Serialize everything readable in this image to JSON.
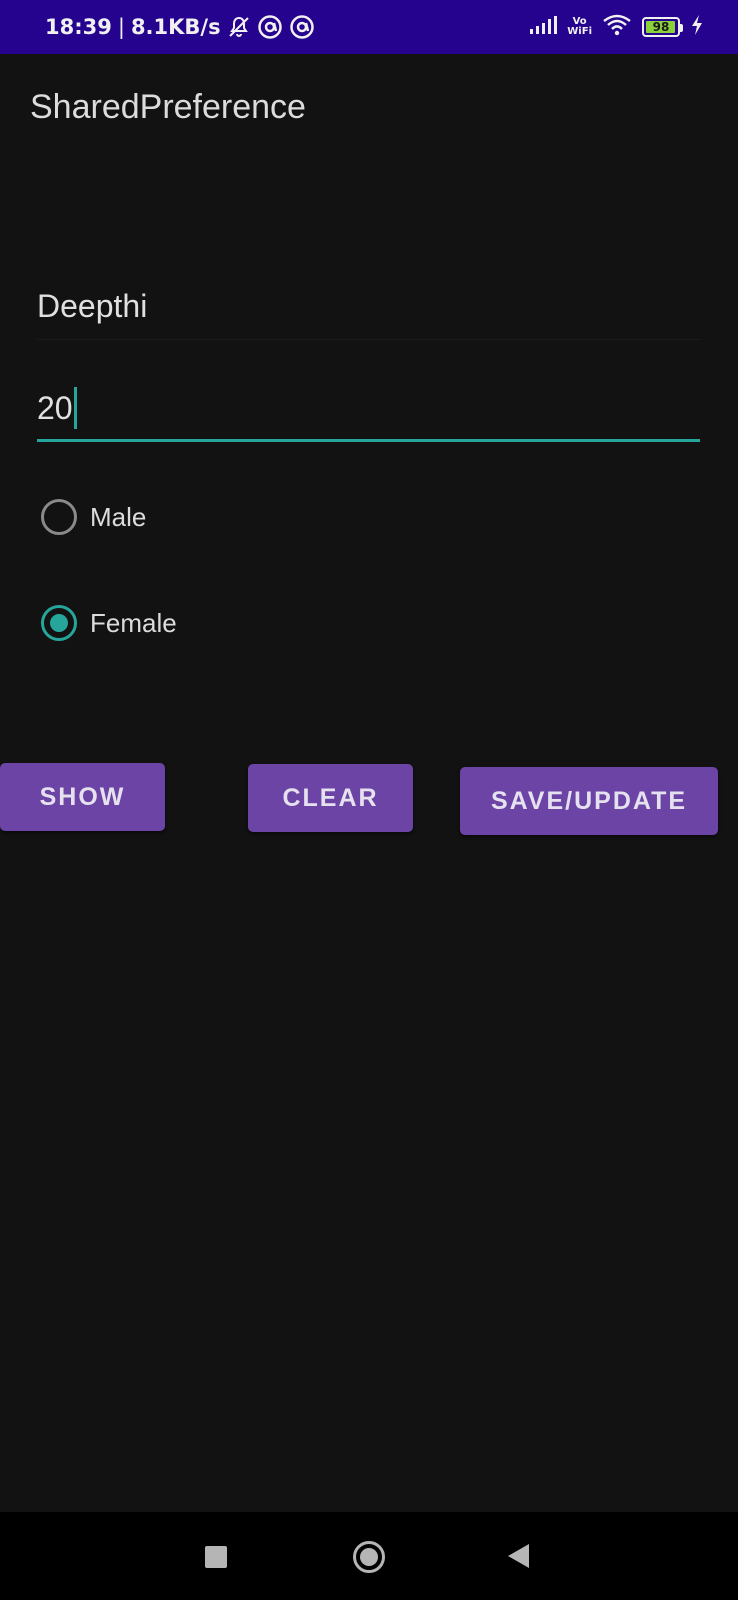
{
  "status_bar": {
    "time": "18:39",
    "separator": "|",
    "network_speed": "8.1KB/s",
    "vowifi_top": "Vo",
    "vowifi_bottom": "WiFi",
    "battery_level": "98",
    "battery_fraction": 0.98,
    "icons": [
      "bell-off-icon",
      "at-sign-icon",
      "at-sign-icon",
      "signal-icon",
      "wifi-icon",
      "battery-icon",
      "charging-bolt-icon"
    ]
  },
  "app_bar": {
    "title": "SharedPreference"
  },
  "form": {
    "name_value": "Deepthi",
    "age_value": "20",
    "gender_options": [
      {
        "label": "Male",
        "checked": false
      },
      {
        "label": "Female",
        "checked": true
      }
    ]
  },
  "buttons": {
    "show": "SHOW",
    "clear": "CLEAR",
    "save_update": "SAVE/UPDATE"
  },
  "nav_bar": {
    "icons": [
      "recents-square-icon",
      "home-circle-icon",
      "back-triangle-icon"
    ]
  },
  "colors": {
    "status_bar": "#25038f",
    "background": "#121212",
    "accent": "#26a69a",
    "button": "#6b44a6"
  }
}
